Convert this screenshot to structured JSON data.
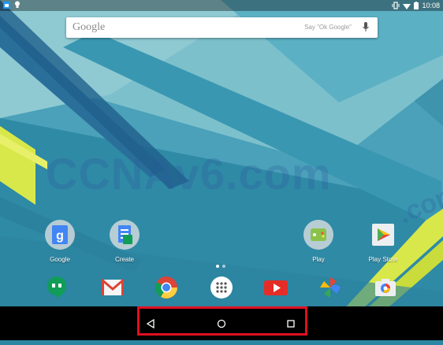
{
  "status_bar": {
    "time": "10:08"
  },
  "search": {
    "logo": "Google",
    "hint": "Say \"Ok Google\""
  },
  "watermark": {
    "text": "CCNAv6.com",
    "fragment": ".com"
  },
  "home_apps": [
    {
      "label": "Google",
      "icon": "google-folder-icon"
    },
    {
      "label": "Create",
      "icon": "create-folder-icon"
    },
    {
      "label": "Play",
      "icon": "play-folder-icon"
    },
    {
      "label": "Play Store",
      "icon": "play-store-icon"
    }
  ],
  "page_indicator": {
    "count": 2,
    "current": 1
  },
  "dock": [
    "hangouts-icon",
    "gmail-icon",
    "chrome-icon",
    "app-drawer-icon",
    "youtube-icon",
    "photos-icon",
    "camera-icon"
  ],
  "nav": [
    "back-icon",
    "home-icon",
    "recents-icon"
  ],
  "colors": {
    "highlight": "#e01020",
    "wallpaper_base": "#4fa8bf"
  }
}
